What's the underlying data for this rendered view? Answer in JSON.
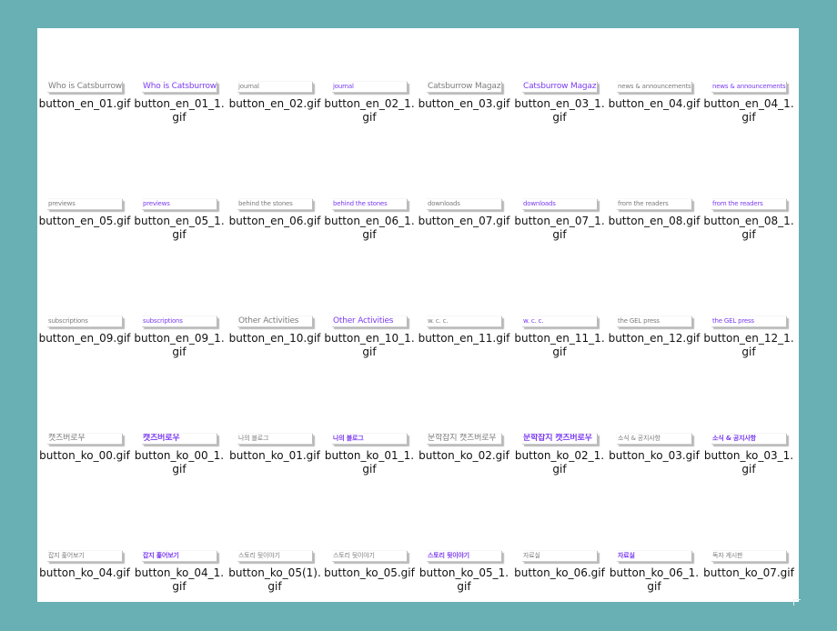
{
  "files": [
    {
      "name": "button_en_01.gif",
      "thumb_text": "Who is Catsburrow?",
      "hover": false,
      "big": true
    },
    {
      "name": "button_en_01_1.gif",
      "thumb_text": "Who is Catsburrow?",
      "hover": true,
      "big": true
    },
    {
      "name": "button_en_02.gif",
      "thumb_text": "journal",
      "hover": false,
      "big": false
    },
    {
      "name": "button_en_02_1.gif",
      "thumb_text": "journal",
      "hover": true,
      "big": false
    },
    {
      "name": "button_en_03.gif",
      "thumb_text": "Catsburrow Magazines",
      "hover": false,
      "big": true
    },
    {
      "name": "button_en_03_1.gif",
      "thumb_text": "Catsburrow Magazines",
      "hover": true,
      "big": true
    },
    {
      "name": "button_en_04.gif",
      "thumb_text": "news & announcements",
      "hover": false,
      "big": false
    },
    {
      "name": "button_en_04_1.gif",
      "thumb_text": "news & announcements",
      "hover": true,
      "big": false
    },
    {
      "name": "button_en_05.gif",
      "thumb_text": "previews",
      "hover": false,
      "big": false
    },
    {
      "name": "button_en_05_1.gif",
      "thumb_text": "previews",
      "hover": true,
      "big": false
    },
    {
      "name": "button_en_06.gif",
      "thumb_text": "behind the stones",
      "hover": false,
      "big": false
    },
    {
      "name": "button_en_06_1.gif",
      "thumb_text": "behind the stones",
      "hover": true,
      "big": false
    },
    {
      "name": "button_en_07.gif",
      "thumb_text": "downloads",
      "hover": false,
      "big": false
    },
    {
      "name": "button_en_07_1.gif",
      "thumb_text": "downloads",
      "hover": true,
      "big": false
    },
    {
      "name": "button_en_08.gif",
      "thumb_text": "from the readers",
      "hover": false,
      "big": false
    },
    {
      "name": "button_en_08_1.gif",
      "thumb_text": "from the readers",
      "hover": true,
      "big": false
    },
    {
      "name": "button_en_09.gif",
      "thumb_text": "subscriptions",
      "hover": false,
      "big": false
    },
    {
      "name": "button_en_09_1.gif",
      "thumb_text": "subscriptions",
      "hover": true,
      "big": false
    },
    {
      "name": "button_en_10.gif",
      "thumb_text": "Other Activities",
      "hover": false,
      "big": true
    },
    {
      "name": "button_en_10_1.gif",
      "thumb_text": "Other Activities",
      "hover": true,
      "big": true
    },
    {
      "name": "button_en_11.gif",
      "thumb_text": "w. c. c.",
      "hover": false,
      "big": false
    },
    {
      "name": "button_en_11_1.gif",
      "thumb_text": "w. c. c.",
      "hover": true,
      "big": false
    },
    {
      "name": "button_en_12.gif",
      "thumb_text": "the GEL press",
      "hover": false,
      "big": false
    },
    {
      "name": "button_en_12_1.gif",
      "thumb_text": "the GEL press",
      "hover": true,
      "big": false
    },
    {
      "name": "button_ko_00.gif",
      "thumb_text": "캣츠버로우",
      "hover": false,
      "big": true
    },
    {
      "name": "button_ko_00_1.gif",
      "thumb_text": "캣츠버로우",
      "hover": true,
      "big": true,
      "bold": true
    },
    {
      "name": "button_ko_01.gif",
      "thumb_text": "나의 블로그",
      "hover": false,
      "big": false
    },
    {
      "name": "button_ko_01_1.gif",
      "thumb_text": "나의 블로그",
      "hover": true,
      "big": false,
      "bold": true
    },
    {
      "name": "button_ko_02.gif",
      "thumb_text": "문학잡지 캣츠버로우",
      "hover": false,
      "big": true
    },
    {
      "name": "button_ko_02_1.gif",
      "thumb_text": "문학잡지 캣츠버로우",
      "hover": true,
      "big": true,
      "bold": true
    },
    {
      "name": "button_ko_03.gif",
      "thumb_text": "소식 & 공지사항",
      "hover": false,
      "big": false
    },
    {
      "name": "button_ko_03_1.gif",
      "thumb_text": "소식 & 공지사항",
      "hover": true,
      "big": false,
      "bold": true
    },
    {
      "name": "button_ko_04.gif",
      "thumb_text": "잡지 훑어보기",
      "hover": false,
      "big": false
    },
    {
      "name": "button_ko_04_1.gif",
      "thumb_text": "잡지 훑어보기",
      "hover": true,
      "big": false,
      "bold": true
    },
    {
      "name": "button_ko_05(1).gif",
      "thumb_text": "스토리 뒷이야기",
      "hover": false,
      "big": false
    },
    {
      "name": "button_ko_05.gif",
      "thumb_text": "스토리 뒷이야기",
      "hover": false,
      "big": false
    },
    {
      "name": "button_ko_05_1.gif",
      "thumb_text": "스토리 뒷이야기",
      "hover": true,
      "big": false,
      "bold": true
    },
    {
      "name": "button_ko_06.gif",
      "thumb_text": "자료실",
      "hover": false,
      "big": false
    },
    {
      "name": "button_ko_06_1.gif",
      "thumb_text": "자료실",
      "hover": true,
      "big": false,
      "bold": true
    },
    {
      "name": "button_ko_07.gif",
      "thumb_text": "독자 게시판",
      "hover": false,
      "big": false
    }
  ]
}
